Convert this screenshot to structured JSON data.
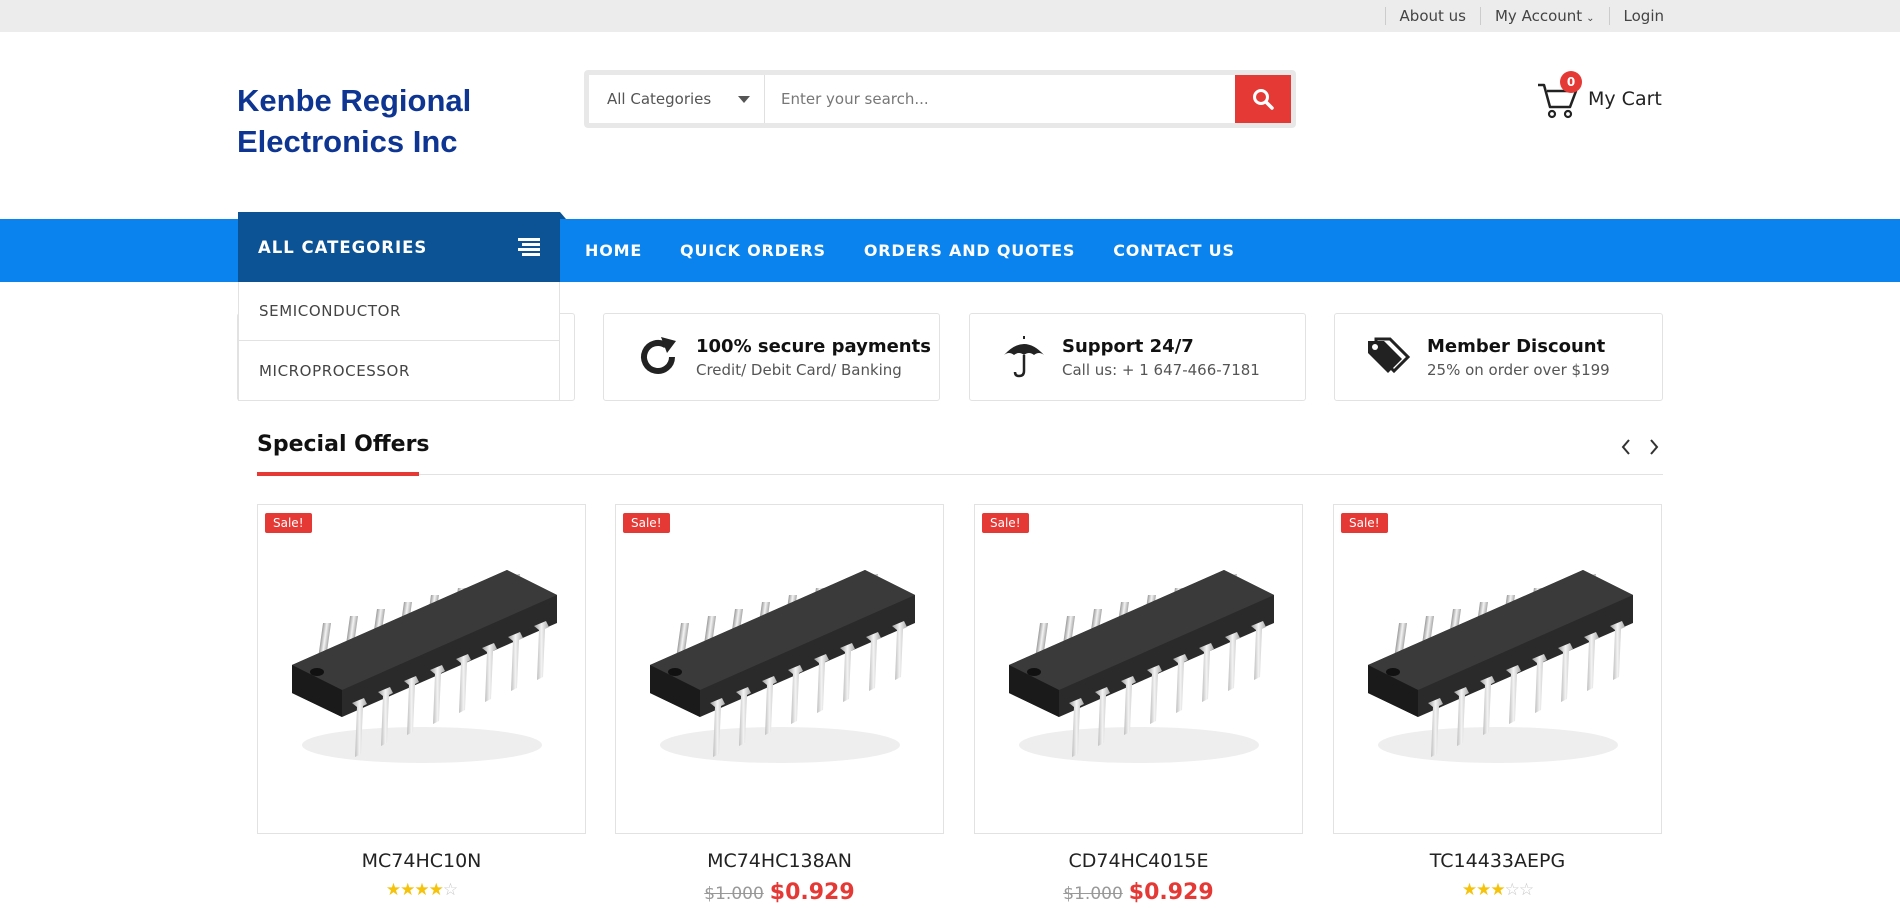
{
  "topbar": {
    "about": "About us",
    "account": "My Account",
    "login": "Login"
  },
  "header": {
    "logo": "Kenbe Regional Electronics Inc",
    "search": {
      "category": "All Categories",
      "placeholder": "Enter your search..."
    },
    "cart": {
      "count": "0",
      "label": "My Cart"
    }
  },
  "nav": {
    "all_categories": "ALL CATEGORIES",
    "links": [
      "HOME",
      "QUICK ORDERS",
      "ORDERS AND QUOTES",
      "CONTACT US"
    ],
    "dropdown": [
      "SEMICONDUCTOR",
      "MICROPROCESSOR"
    ]
  },
  "features": [
    {
      "icon": "refresh-icon",
      "title": "100% secure payments",
      "sub": "Credit/ Debit Card/ Banking"
    },
    {
      "icon": "umbrella-icon",
      "title": "Support 24/7",
      "sub": "Call us: + 1 647-466-7181"
    },
    {
      "icon": "tags-icon",
      "title": "Member Discount",
      "sub": "25% on order over $199"
    }
  ],
  "special_offers": {
    "title": "Special Offers",
    "products": [
      {
        "badge": "Sale!",
        "name": "MC74HC10N",
        "rating": 4,
        "old_price": "",
        "price": ""
      },
      {
        "badge": "Sale!",
        "name": "MC74HC138AN",
        "rating": 0,
        "old_price": "$1.000",
        "price": "$0.929"
      },
      {
        "badge": "Sale!",
        "name": "CD74HC4015E",
        "rating": 0,
        "old_price": "$1.000",
        "price": "$0.929"
      },
      {
        "badge": "Sale!",
        "name": "TC14433AEPG",
        "rating": 3,
        "old_price": "",
        "price": ""
      }
    ]
  },
  "colors": {
    "nav_blue": "#0a83ee",
    "category_blue": "#0b5394",
    "accent_red": "#e53935",
    "logo_blue": "#0d3591"
  }
}
